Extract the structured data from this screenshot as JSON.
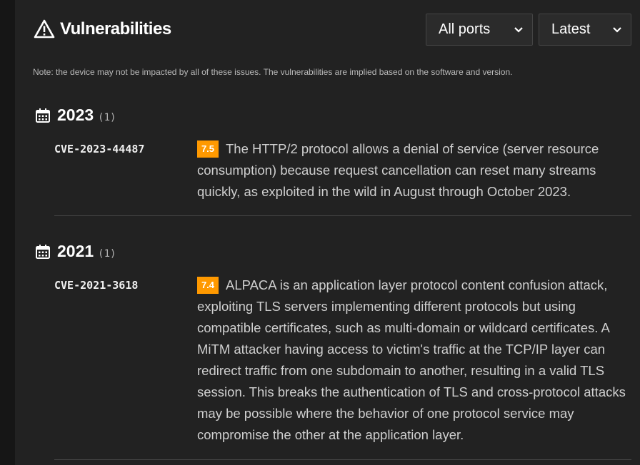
{
  "header": {
    "title": "Vulnerabilities",
    "icon": "warning-icon",
    "ports_select": {
      "selected": "All ports"
    },
    "sort_select": {
      "selected": "Latest"
    }
  },
  "note": "Note: the device may not be impacted by all of these issues. The vulnerabilities are implied based on the software and version.",
  "groups": [
    {
      "year": "2023",
      "count": "(1)",
      "items": [
        {
          "cve": "CVE-2023-44487",
          "score": "7.5",
          "description": "The HTTP/2 protocol allows a denial of service (server resource consumption) because request cancellation can reset many streams quickly, as exploited in the wild in August through October 2023."
        }
      ]
    },
    {
      "year": "2021",
      "count": "(1)",
      "items": [
        {
          "cve": "CVE-2021-3618",
          "score": "7.4",
          "description": "ALPACA is an application layer protocol content confusion attack, exploiting TLS servers implementing different protocols but using compatible certificates, such as multi-domain or wildcard certificates. A MiTM attacker having access to victim's traffic at the TCP/IP layer can redirect traffic from one subdomain to another, resulting in a valid TLS session. This breaks the authentication of TLS and cross-protocol attacks may be possible where the behavior of one protocol service may compromise the other at the application layer."
        }
      ]
    }
  ],
  "colors": {
    "background": "#222222",
    "badge": "#ff9900",
    "divider": "#444444"
  }
}
